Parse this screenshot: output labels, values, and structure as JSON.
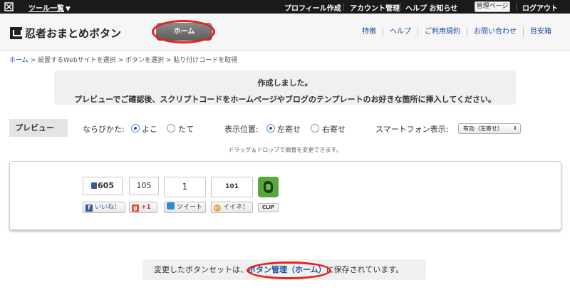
{
  "topbar": {
    "tool_menu": "ツール一覧",
    "nav": [
      "プロフィール作成",
      "アカウント管理",
      "ヘルプ お知らせ"
    ],
    "admin_button": "管理ページ",
    "logout": "ログアウト"
  },
  "header": {
    "brand": "忍者おまとめボタン",
    "home_button": "ホーム",
    "right_nav": [
      "特徴",
      "ヘルプ",
      "ご利用規約",
      "お問い合わせ",
      "目安箱"
    ]
  },
  "breadcrumb": {
    "items": [
      "ホーム",
      "設置するWebサイトを選択",
      "ボタンを選択",
      "貼り付けコードを取得"
    ],
    "separator": ">"
  },
  "notice": {
    "line1": "作成しました。",
    "line2": "プレビューでご確認後、スクリプトコードをホームページやブログのテンプレートのお好きな箇所に挿入してください。"
  },
  "preview": {
    "tag": "プレビュー",
    "layout_label": "ならびかた:",
    "layout_options": [
      "よこ",
      "たて"
    ],
    "layout_selected": "よこ",
    "position_label": "表示位置:",
    "position_options": [
      "左寄せ",
      "右寄せ"
    ],
    "position_selected": "左寄せ",
    "smartphone_label": "スマートフォン表示:",
    "smartphone_value": "有効（左寄せ）",
    "drag_hint": "ドラッグ＆ドロップで順番を変更できます。"
  },
  "buttons": {
    "facebook_count": "605",
    "facebook_label": "いいね！",
    "google_count": "105",
    "google_label": "+1",
    "twitter_count": "1",
    "twitter_label": "ツイート",
    "mixi_count": "101",
    "mixi_label": "イイネ！",
    "evernote_label": "CLIP"
  },
  "save_notice": {
    "before": "変更したボタンセットは、",
    "link": "ボタン管理（ホーム）",
    "after": "に保存されています。"
  },
  "colors": {
    "topbar_bg": "#1a1a1a",
    "link": "#1a4fa0",
    "highlight_ring": "#e3231d",
    "facebook": "#3b5998",
    "google": "#dd4b39",
    "evernote": "#5aa63a"
  }
}
